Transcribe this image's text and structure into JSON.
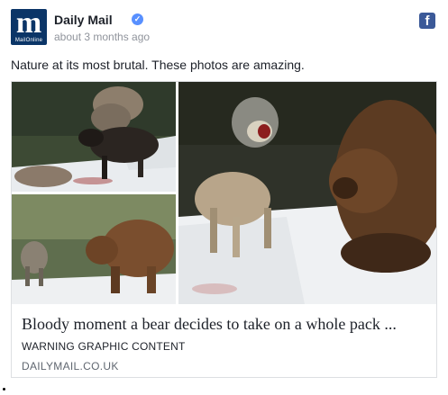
{
  "page": {
    "name": "Daily Mail",
    "avatar_letter": "m",
    "avatar_sub": "MailOnline",
    "verified": true,
    "timestamp": "about 3 months ago",
    "facebook_icon": "facebook-icon"
  },
  "post": {
    "text": "Nature at its most brutal. These photos are amazing."
  },
  "link_card": {
    "headline": "Bloody moment a bear decides to take on a whole pack ...",
    "subtitle": "WARNING GRAPHIC CONTENT",
    "domain": "DAILYMAIL.CO.UK"
  },
  "colors": {
    "avatar_bg": "#0b3567",
    "verified": "#5890ff",
    "facebook": "#3b5998",
    "meta_text": "#90949c"
  }
}
